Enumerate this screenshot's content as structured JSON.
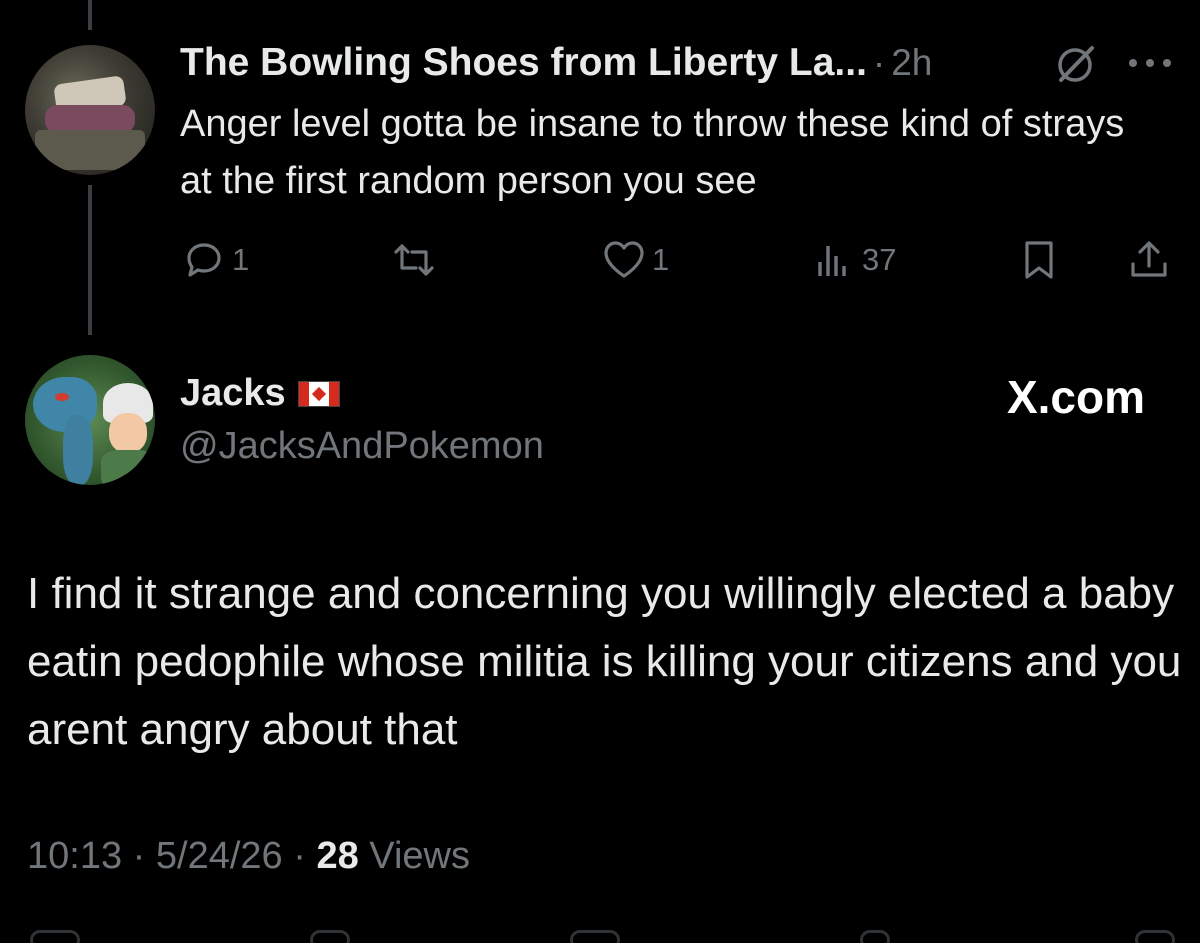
{
  "reply": {
    "author_name": "The Bowling Shoes from Liberty La...",
    "separator": "·",
    "time": "2h",
    "text": "Anger level gotta be insane to throw these kind of strays at the first random person you see",
    "actions": {
      "reply_count": "1",
      "repost_count": "",
      "like_count": "1",
      "view_count": "37"
    },
    "icons": [
      "grok-icon",
      "more-icon",
      "reply-icon",
      "repost-icon",
      "like-icon",
      "views-icon",
      "bookmark-icon",
      "share-icon"
    ]
  },
  "tweet": {
    "author_name": "Jacks",
    "flag": "Canada",
    "handle": "@JacksAndPokemon",
    "brand": "X.com",
    "text": "I find it strange and concerning you willingly elected a baby eatin pedophile whose militia is killing your citizens and you arent angry about that",
    "time": "10:13",
    "date": "5/24/26",
    "separator": "·",
    "views_count": "28",
    "views_label": "Views"
  },
  "colors": {
    "background": "#000000",
    "primary_text": "#e7e9ea",
    "secondary_text": "#71767b",
    "thread_line": "#3a3d41"
  }
}
